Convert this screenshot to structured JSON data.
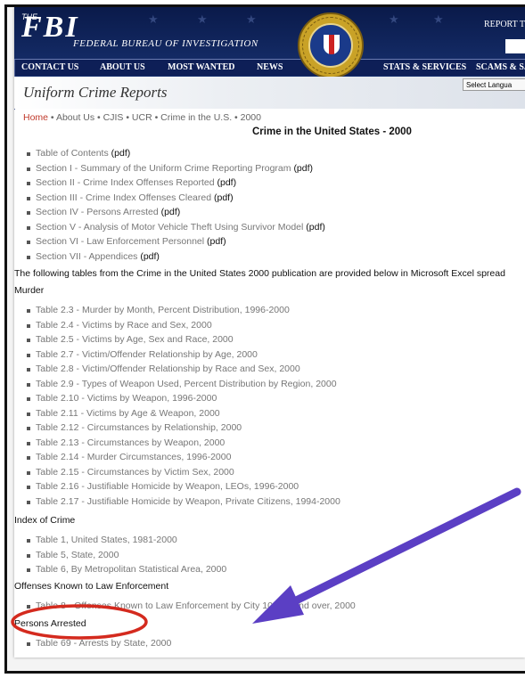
{
  "header": {
    "logo_the": "THE",
    "logo_fbi": "FBI",
    "logo_text": "FEDERAL BUREAU OF INVESTIGATION",
    "report": "REPORT T",
    "seal_label": "DEPARTMENT OF JUSTICE · FEDERAL BUREAU OF INVESTIGATION"
  },
  "nav": {
    "items": [
      "CONTACT US",
      "ABOUT US",
      "MOST WANTED",
      "NEWS",
      "STATS & SERVICES",
      "SCAMS & S..."
    ]
  },
  "ucr": {
    "title": "Uniform Crime Reports",
    "language_select": "Select Langua"
  },
  "breadcrumb": {
    "home": "Home",
    "rest": " • About Us • CJIS • UCR • Crime in the U.S. • 2000"
  },
  "page_title": "Crime in the United States - 2000",
  "sections": [
    {
      "label": "Table of Contents",
      "suffix": "(pdf)"
    },
    {
      "label": "Section I - Summary of the Uniform Crime Reporting Program",
      "suffix": "(pdf)"
    },
    {
      "label": "Section II - Crime Index Offenses Reported",
      "suffix": "(pdf)"
    },
    {
      "label": "Section III - Crime Index Offenses Cleared",
      "suffix": "(pdf)"
    },
    {
      "label": "Section IV - Persons Arrested",
      "suffix": "(pdf)"
    },
    {
      "label": "Section V - Analysis of Motor Vehicle Theft Using Survivor Model",
      "suffix": "(pdf)"
    },
    {
      "label": "Section VI - Law Enforcement Personnel",
      "suffix": "(pdf)"
    },
    {
      "label": "Section VII - Appendices",
      "suffix": "(pdf)"
    }
  ],
  "intro": "The following tables from the Crime in the United States 2000 publication are provided below in Microsoft Excel spread",
  "murder": {
    "heading": "Murder",
    "tables": [
      "Table 2.3 - Murder by Month, Percent Distribution, 1996-2000",
      "Table 2.4 - Victims by Race and Sex, 2000",
      "Table 2.5 - Victims by Age, Sex and Race, 2000",
      "Table 2.7 - Victim/Offender Relationship by Age, 2000",
      "Table 2.8 - Victim/Offender Relationship by Race and Sex, 2000",
      "Table 2.9 - Types of Weapon Used, Percent Distribution by Region, 2000",
      "Table 2.10 - Victims by Weapon, 1996-2000",
      "Table 2.11 - Victims by Age & Weapon, 2000",
      "Table 2.12 - Circumstances by Relationship, 2000",
      "Table 2.13 - Circumstances by Weapon, 2000",
      "Table 2.14 - Murder Circumstances, 1996-2000",
      "Table 2.15 - Circumstances by Victim Sex, 2000",
      "Table 2.16 - Justifiable Homicide by Weapon, LEOs, 1996-2000",
      "Table 2.17 - Justifiable Homicide by Weapon, Private Citizens, 1994-2000"
    ]
  },
  "index": {
    "heading": "Index of Crime",
    "tables": [
      "Table 1, United States, 1981-2000",
      "Table 5, State, 2000",
      "Table 6, By Metropolitan Statistical Area, 2000"
    ]
  },
  "leo": {
    "heading": "Offenses Known to Law Enforcement",
    "tables": [
      "Table 8 - Offenses Known to Law Enforcement by City 10,000 and over, 2000"
    ]
  },
  "arrested": {
    "heading": "Persons Arrested",
    "tables": [
      "Table 69 - Arrests by State, 2000"
    ]
  },
  "colors": {
    "header_navy": "#0a1a4a",
    "link_red": "#c0392b",
    "annotation_red": "#d42a1e",
    "annotation_arrow": "#5b3fc4"
  }
}
